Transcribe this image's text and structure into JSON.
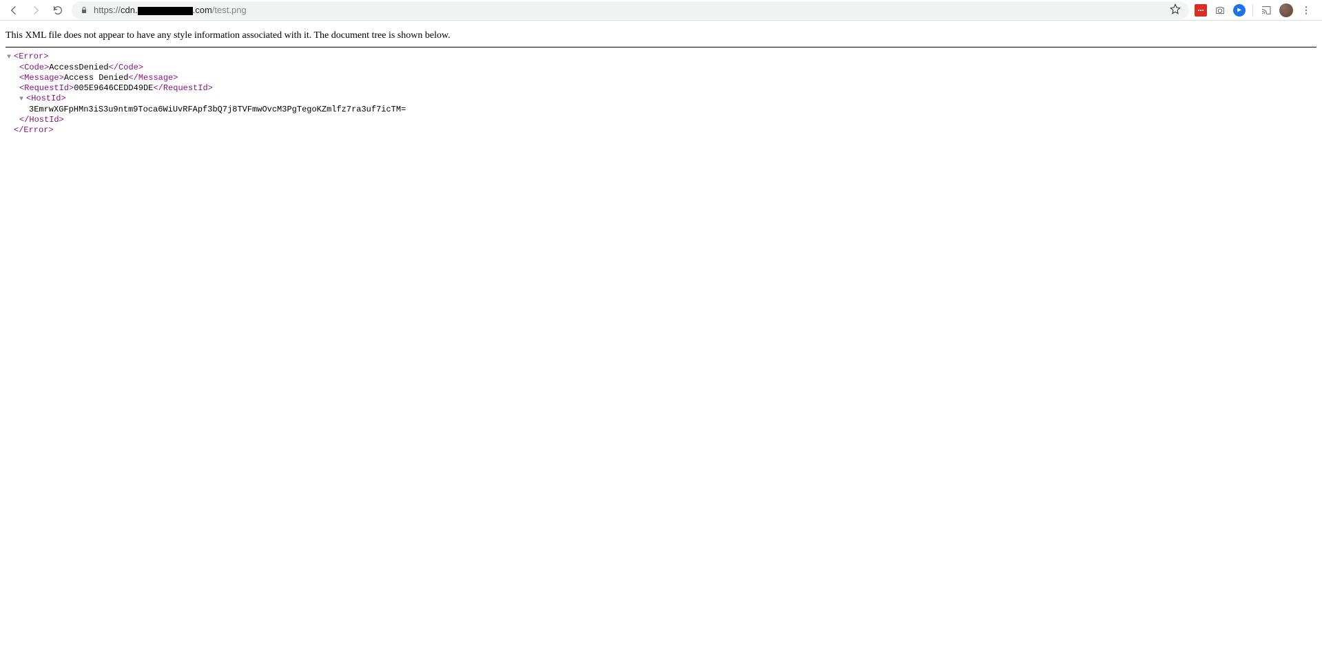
{
  "url": {
    "scheme": "https://",
    "host_prefix": "cdn.",
    "host_suffix": ".com",
    "path": "/test.png"
  },
  "info_message": "This XML file does not appear to have any style information associated with it. The document tree is shown below.",
  "xml": {
    "root_open": "<Error>",
    "code_open": "<Code>",
    "code_value": "AccessDenied",
    "code_close": "</Code>",
    "message_open": "<Message>",
    "message_value": "Access Denied",
    "message_close": "</Message>",
    "requestid_open": "<RequestId>",
    "requestid_value": "005E9646CEDD49DE",
    "requestid_close": "</RequestId>",
    "hostid_open": "<HostId>",
    "hostid_value": "3EmrwXGFpHMn3iS3u9ntm9Toca6WiUvRFApf3bQ7j8TVFmwOvcM3PgTegoKZmlfz7ra3uf7icTM=",
    "hostid_close": "</HostId>",
    "root_close": "</Error>"
  },
  "toggle_glyph": "▼"
}
